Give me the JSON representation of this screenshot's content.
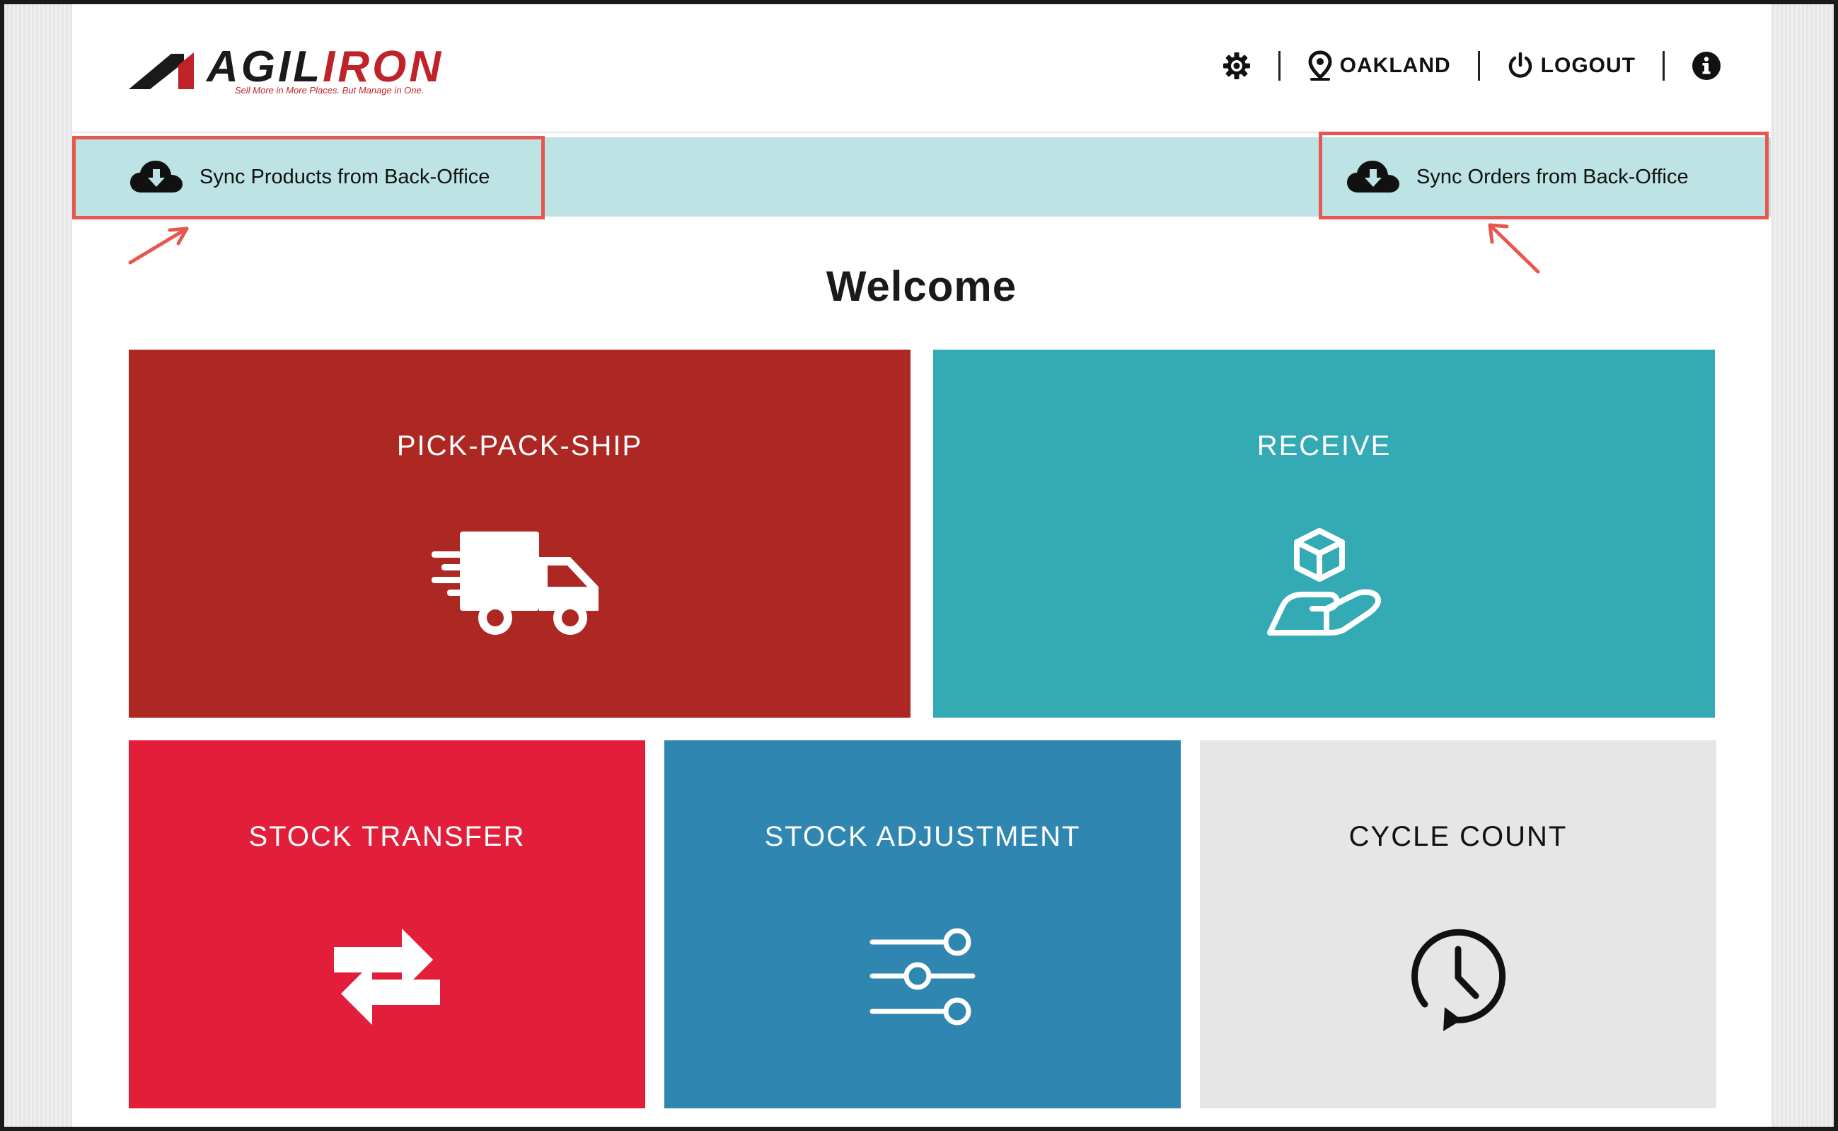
{
  "logo": {
    "brand_left": "AGIL",
    "brand_right": "IRON",
    "tagline": "Sell More in More Places. But Manage in One."
  },
  "nav": {
    "location": "OAKLAND",
    "logout": "LOGOUT"
  },
  "sync": {
    "products": "Sync Products from Back-Office",
    "orders": "Sync Orders from Back-Office"
  },
  "welcome": "Welcome",
  "tiles": [
    {
      "title": "PICK-PACK-SHIP",
      "color": "#ad2723",
      "icon": "delivery-truck-icon"
    },
    {
      "title": "RECEIVE",
      "color": "#34aab4",
      "icon": "hand-box-icon"
    },
    {
      "title": "STOCK TRANSFER",
      "color": "#e21e3a",
      "icon": "transfer-arrows-icon"
    },
    {
      "title": "STOCK ADJUSTMENT",
      "color": "#2e86b1",
      "icon": "sliders-icon"
    },
    {
      "title": "CYCLE COUNT",
      "color": "#e6e6e6",
      "icon": "history-clock-icon"
    }
  ],
  "colors": {
    "sync_bar": "#bde3e5",
    "highlight": "#e8574f",
    "brand_red": "#c0222a"
  }
}
